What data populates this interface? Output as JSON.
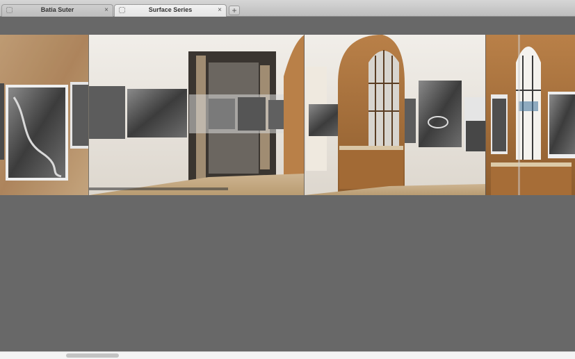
{
  "tabs": [
    {
      "title": "Batia Suter",
      "active": false
    },
    {
      "title": "Surface Series",
      "active": true
    }
  ],
  "icons": {
    "favicon": "placeholder-page-icon",
    "close": "×",
    "new_tab": "+"
  },
  "panorama": {
    "description_colors": {
      "wall": "#e8e3dc",
      "wood": "#a8743f",
      "floor": "#c9b08a",
      "background": "#686868"
    }
  }
}
